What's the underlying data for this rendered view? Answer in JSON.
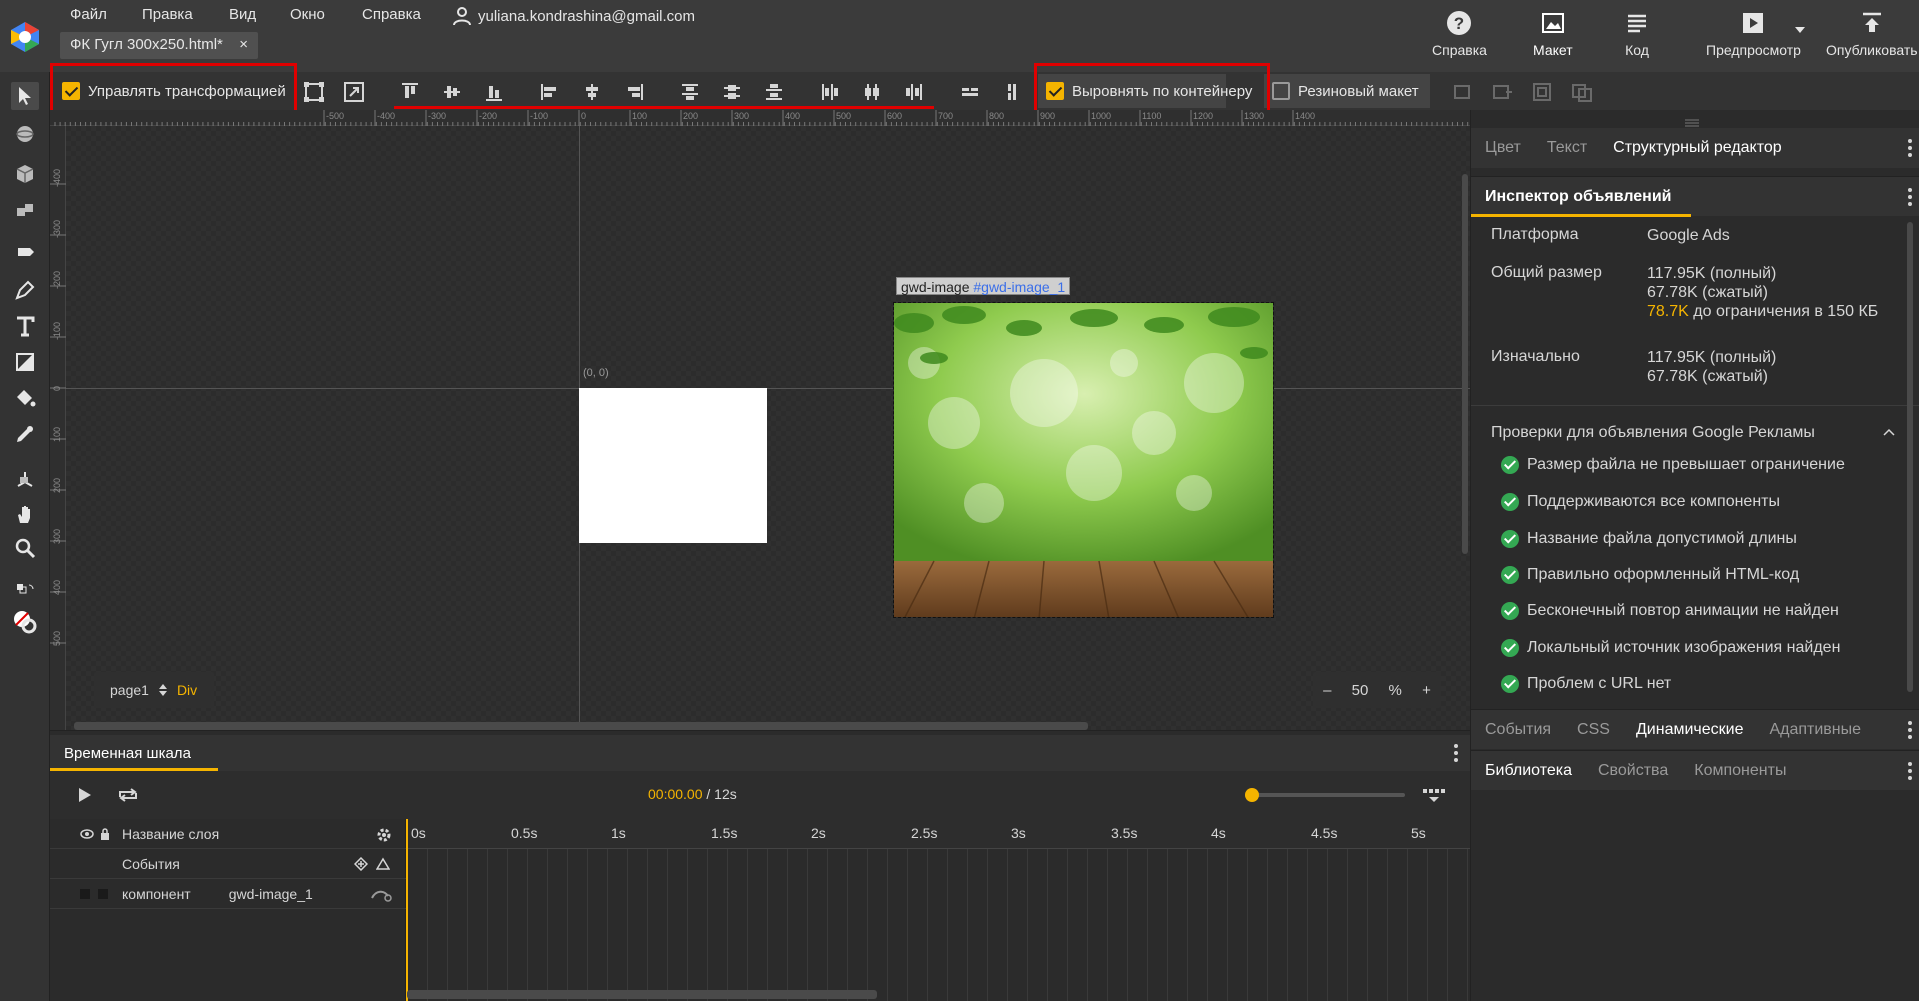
{
  "menu": {
    "items": [
      "Файл",
      "Правка",
      "Вид",
      "Окно",
      "Справка"
    ],
    "user_email": "yuliana.kondrashina@gmail.com"
  },
  "document_tab": {
    "title": "ФК Гугл 300x250.html*",
    "close": "×"
  },
  "top_buttons": {
    "help": "Справка",
    "layout": "Макет",
    "code": "Код",
    "preview": "Предпросмотр",
    "publish": "Опубликовать"
  },
  "toolbar": {
    "transform_label": "Управлять трансформацией",
    "transform_checked": true,
    "align_container_label": "Выровнять по контейнеру",
    "align_container_checked": true,
    "responsive_label": "Резиновый макет",
    "responsive_checked": false
  },
  "ruler_h": [
    "-500",
    "-400",
    "-300",
    "-200",
    "-100",
    "0",
    "100",
    "200",
    "300",
    "400",
    "500",
    "600",
    "700",
    "800",
    "900",
    "1000",
    "1100",
    "1200",
    "1300",
    "1400"
  ],
  "ruler_v": [
    "-400",
    "-300",
    "-200",
    "-100",
    "0",
    "100",
    "200",
    "300",
    "400",
    "500"
  ],
  "stage": {
    "origin_label": "(0, 0)",
    "element_tag": "gwd-image",
    "element_id": "#gwd-image_1",
    "page_name": "page1",
    "page_type": "Div",
    "zoom_minus": "–",
    "zoom_value": "50",
    "zoom_unit": "%",
    "zoom_plus": "+"
  },
  "timeline": {
    "tab_label": "Временная шкала",
    "current_time": "00:00.00",
    "total_time": "/ 12s",
    "layer_header": "Название слоя",
    "events_row": "События",
    "component_type": "компонент",
    "component_name": "gwd-image_1",
    "ticks": [
      "0s",
      "0.5s",
      "1s",
      "1.5s",
      "2s",
      "2.5s",
      "3s",
      "3.5s",
      "4s",
      "4.5s",
      "5s"
    ]
  },
  "right_panel": {
    "tabs_top": [
      "Цвет",
      "Текст",
      "Структурный редактор"
    ],
    "tabs_top_active": "Структурный редактор",
    "inspector_title": "Инспектор объявлений",
    "platform_label": "Платформа",
    "platform_value": "Google Ads",
    "total_size_label": "Общий размер",
    "total_size_full": "117.95K (полный)",
    "total_size_compressed": "67.78K (сжатый)",
    "limit_value": "78.7K",
    "limit_text": " до ограничения в 150 КБ",
    "initial_label": "Изначально",
    "initial_full": "117.95K (полный)",
    "initial_compressed": "67.78K (сжатый)",
    "checks_title": "Проверки для объявления Google Рекламы",
    "checks": [
      "Размер файла не превышает ограничение",
      "Поддерживаются все компоненты",
      "Название файла допустимой длины",
      "Правильно оформленный HTML-код",
      "Бесконечный повтор анимации не найден",
      "Локальный источник изображения найден",
      "Проблем с URL нет"
    ],
    "tabs_mid": [
      "События",
      "CSS",
      "Динамические",
      "Адаптивные"
    ],
    "tabs_mid_active": "Динамические",
    "tabs_bottom": [
      "Библиотека",
      "Свойства",
      "Компоненты"
    ],
    "tabs_bottom_active": "Библиотека"
  },
  "colors": {
    "accent": "#f5b400",
    "highlight_box": "#e00000",
    "ok": "#34a853",
    "link": "#3a6ee8"
  }
}
